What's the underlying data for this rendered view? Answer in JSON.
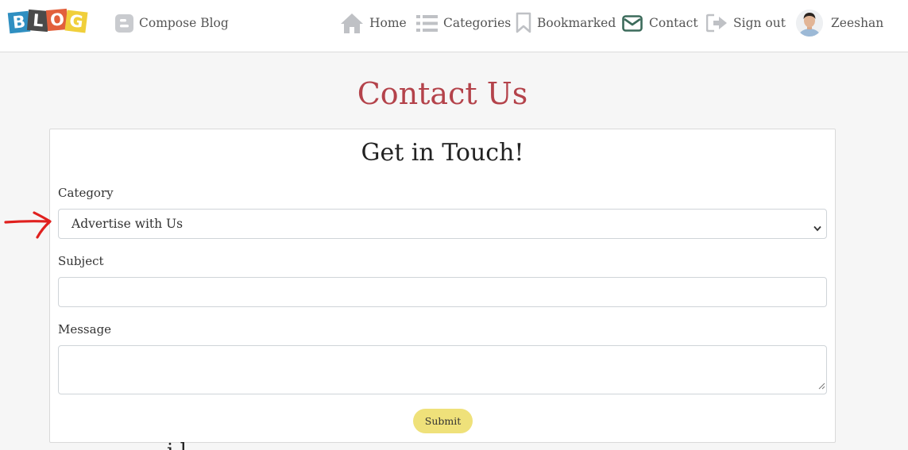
{
  "brand": {
    "letters": [
      "B",
      "L",
      "O",
      "G"
    ],
    "tile_colors": [
      "#2f8fc1",
      "#4a4a4a",
      "#e2603c",
      "#f0cf3b"
    ]
  },
  "nav": {
    "compose": {
      "label": "Compose Blog",
      "icon": "blogger-icon"
    },
    "home": {
      "label": "Home",
      "icon": "home-icon"
    },
    "categories": {
      "label": "Categories",
      "icon": "list-icon"
    },
    "bookmarked": {
      "label": "Bookmarked",
      "icon": "bookmark-icon"
    },
    "contact": {
      "label": "Contact",
      "icon": "envelope-icon",
      "active_color": "#3c6b5b"
    },
    "signout": {
      "label": "Sign out",
      "icon": "sign-out-icon"
    },
    "user": {
      "name": "Zeeshan",
      "icon": "avatar"
    }
  },
  "page": {
    "title": "Contact Us",
    "title_color": "#b4434b"
  },
  "form": {
    "heading": "Get in Touch!",
    "category": {
      "label": "Category",
      "selected": "Advertise with Us",
      "icon": "chevron-down-icon"
    },
    "subject": {
      "label": "Subject",
      "value": "",
      "placeholder": ""
    },
    "message": {
      "label": "Message",
      "value": "",
      "placeholder": ""
    },
    "submit_label": "Submit",
    "submit_color": "#efe17a"
  },
  "annotation": {
    "icon": "red-arrow-icon",
    "color": "#e0201e"
  },
  "footer_fragment": {
    "text": "i l"
  }
}
